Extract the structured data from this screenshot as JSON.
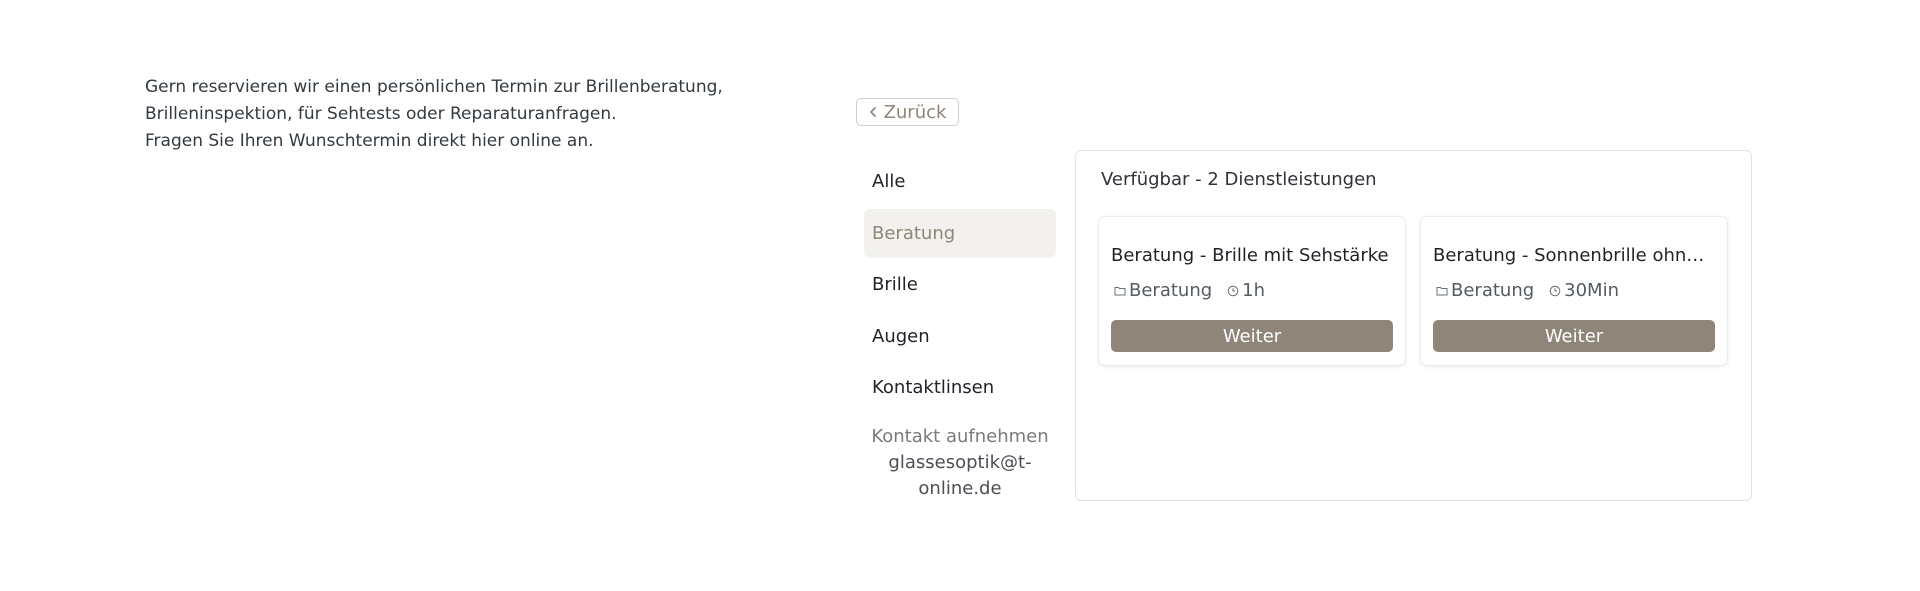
{
  "intro": {
    "line1": "Gern reservieren wir einen persönlichen Termin zur Brillenberatung,",
    "line2": "Brilleninspektion, für Sehtests oder Reparaturanfragen.",
    "line3": "Fragen Sie Ihren Wunschtermin direkt hier online an."
  },
  "back_label": "Zurück",
  "sidebar": {
    "items": [
      {
        "label": "Alle"
      },
      {
        "label": "Beratung"
      },
      {
        "label": "Brille"
      },
      {
        "label": "Augen"
      },
      {
        "label": "Kontaktlinsen"
      }
    ],
    "active": "Beratung"
  },
  "contact": {
    "label": "Kontakt aufnehmen",
    "email_line1": "glassesoptik@t-",
    "email_line2": "online.de"
  },
  "panel": {
    "title": "Verfügbar - 2 Dienstleistungen",
    "services": [
      {
        "title": "Beratung - Brille mit Sehstärke",
        "category": "Beratung",
        "duration": "1h",
        "button": "Weiter"
      },
      {
        "title": "Beratung - Sonnenbrille ohne ...",
        "category": "Beratung",
        "duration": "30Min",
        "button": "Weiter"
      }
    ]
  },
  "icons": {
    "back": "chevron-left-icon",
    "category": "folder-icon",
    "duration": "clock-icon"
  },
  "colors": {
    "accent": "#8f8578",
    "active_bg": "#f3f1ee"
  }
}
